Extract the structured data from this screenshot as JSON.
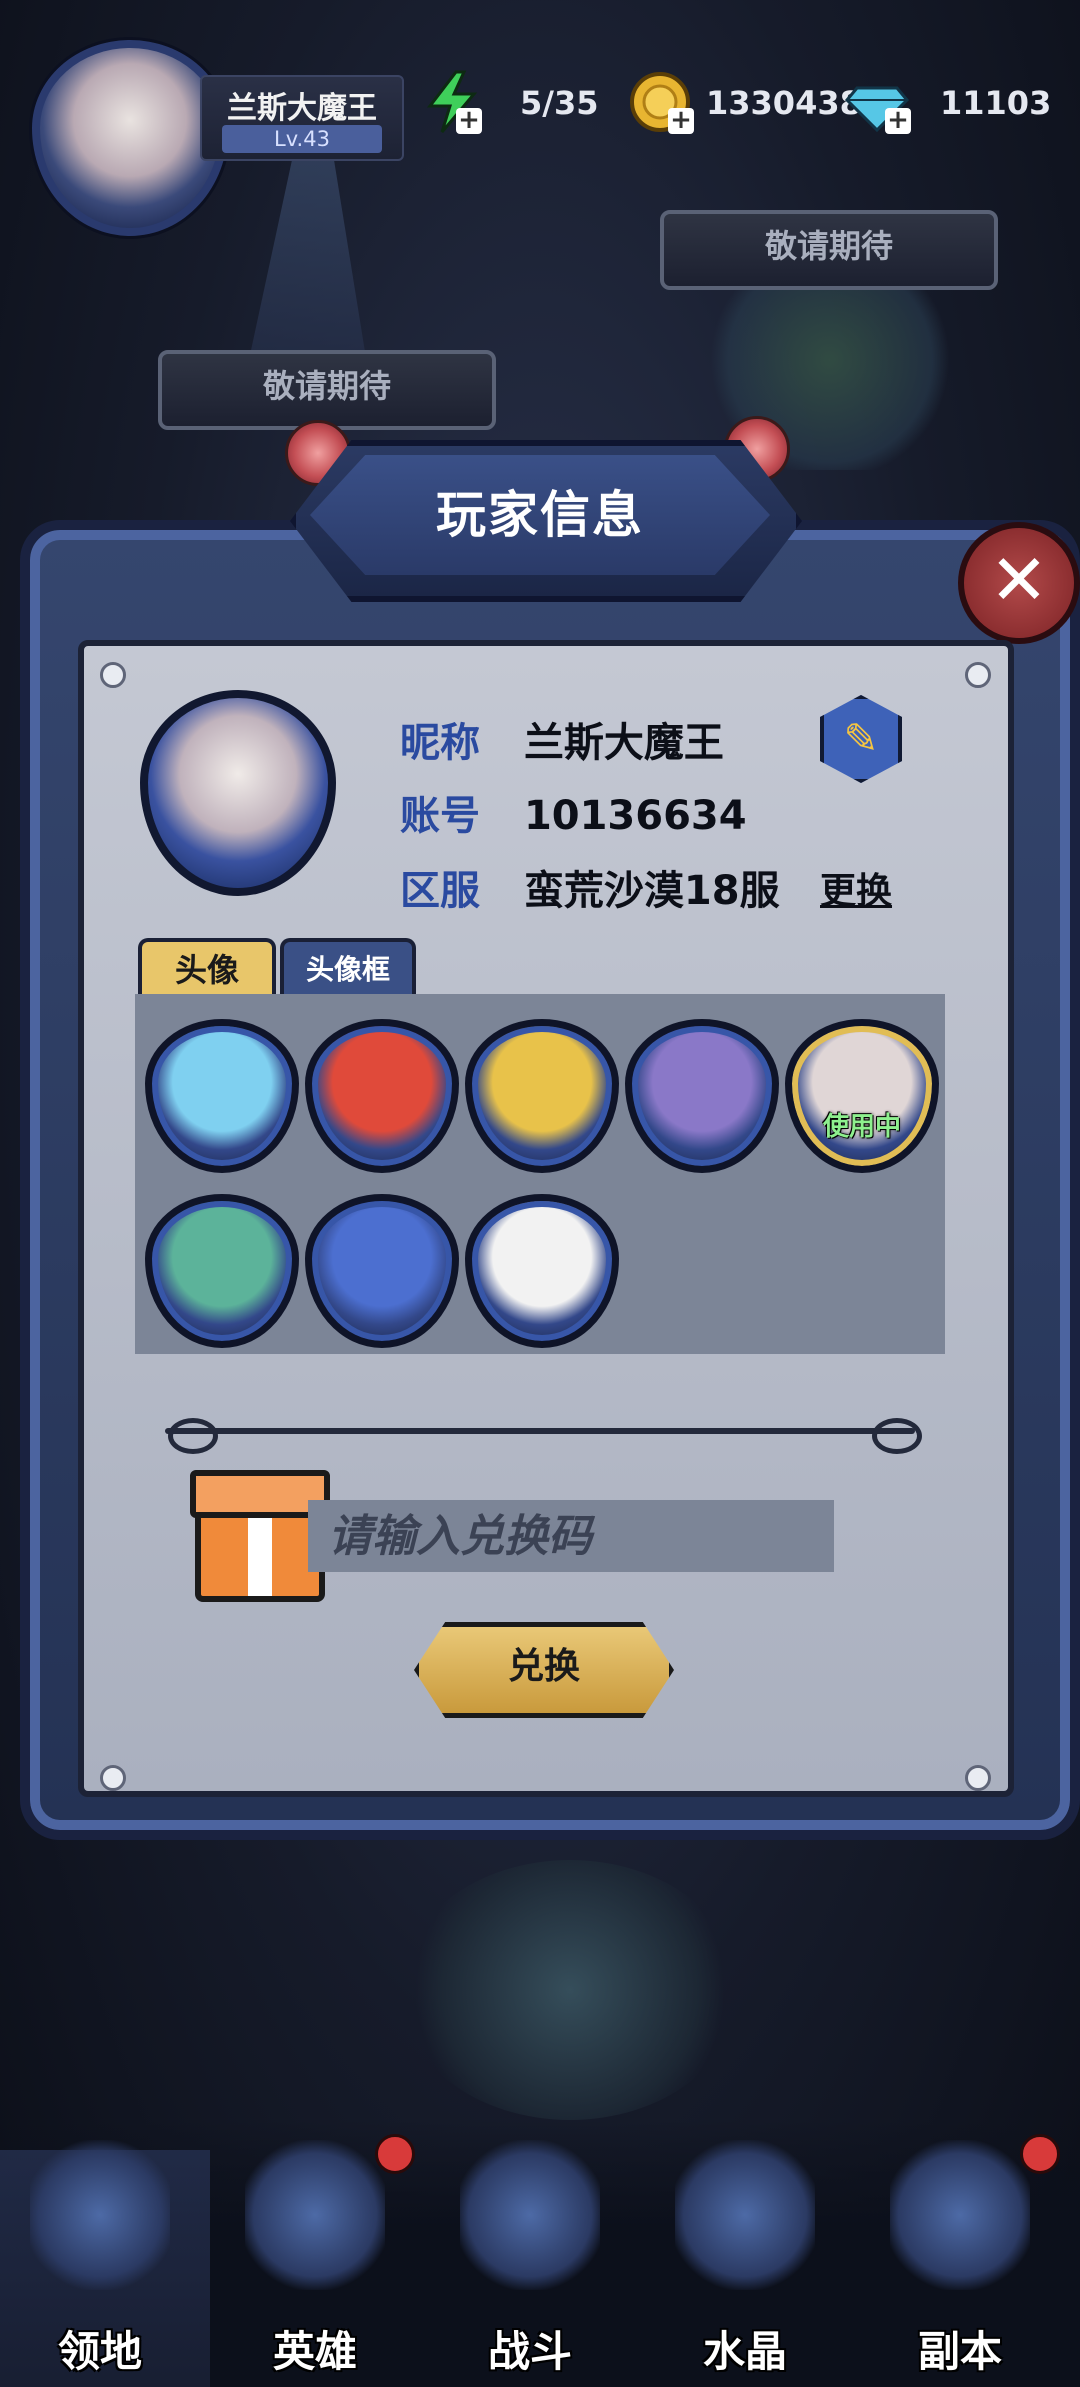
{
  "hud": {
    "player_name": "兰斯大魔王",
    "level": "Lv.43",
    "energy": "5/35",
    "gold": "1330438",
    "gems": "11103"
  },
  "banners": {
    "coming_soon_left": "敬请期待",
    "coming_soon_right": "敬请期待"
  },
  "modal": {
    "title": "玩家信息",
    "nickname_label": "昵称",
    "nickname": "兰斯大魔王",
    "account_label": "账号",
    "account": "10136634",
    "server_label": "区服",
    "server": "蛮荒沙漠18服",
    "change_label": "更换",
    "tabs": [
      {
        "label": "头像",
        "active": true
      },
      {
        "label": "头像框",
        "active": false
      }
    ],
    "in_use_label": "使用中",
    "redeem_placeholder": "请输入兑换码",
    "redeem_button": "兑换"
  },
  "avatars": [
    {
      "name": "diver-robot",
      "color": "#7fd0f0"
    },
    {
      "name": "red-bomb",
      "color": "#e04a3a"
    },
    {
      "name": "knight",
      "color": "#e8c24a"
    },
    {
      "name": "mummy-nun",
      "color": "#8a78c8"
    },
    {
      "name": "vampire-queen",
      "color": "#e0d6d6",
      "selected": true
    },
    {
      "name": "medusa",
      "color": "#5cb39a"
    },
    {
      "name": "blue-dragon",
      "color": "#4c6fd0"
    },
    {
      "name": "panda",
      "color": "#f2f2f2"
    }
  ],
  "nav": [
    {
      "label": "领地",
      "dot": false
    },
    {
      "label": "英雄",
      "dot": true
    },
    {
      "label": "战斗",
      "dot": false
    },
    {
      "label": "水晶",
      "dot": false
    },
    {
      "label": "副本",
      "dot": true
    }
  ]
}
